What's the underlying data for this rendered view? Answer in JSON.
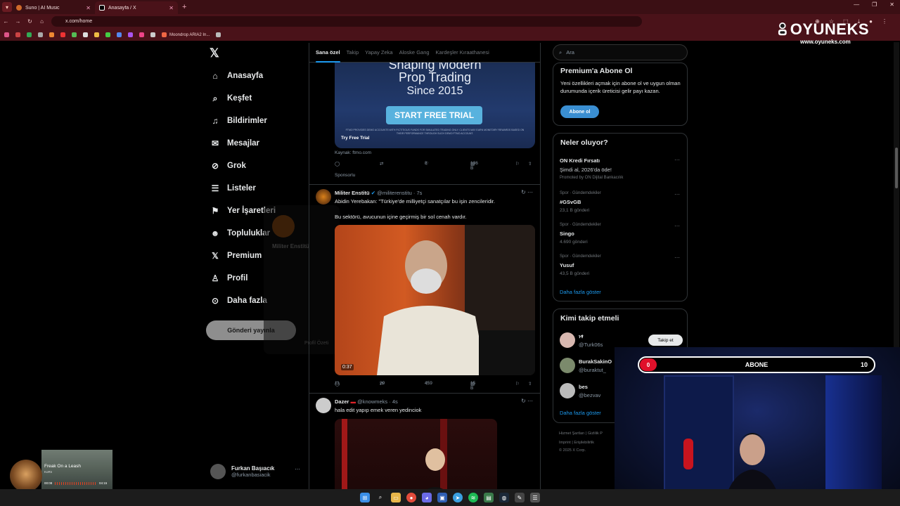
{
  "browser": {
    "tabs": [
      {
        "title": "Suno | AI Music",
        "active": false
      },
      {
        "title": "Anasayfa / X",
        "active": true
      }
    ],
    "url": "x.com/home",
    "bookmark_label": "Moondrop ARIA2 In..."
  },
  "overlay_logo": {
    "brand": "OYUNEKS",
    "site": "www.oyuneks.com"
  },
  "nav": {
    "items": [
      {
        "label": "Anasayfa",
        "icon": "home-icon"
      },
      {
        "label": "Keşfet",
        "icon": "search-icon"
      },
      {
        "label": "Bildirimler",
        "icon": "bell-icon"
      },
      {
        "label": "Mesajlar",
        "icon": "mail-icon"
      },
      {
        "label": "Grok",
        "icon": "grok-icon"
      },
      {
        "label": "Listeler",
        "icon": "list-icon"
      },
      {
        "label": "Yer İşaretleri",
        "icon": "bookmark-icon"
      },
      {
        "label": "Topluluklar",
        "icon": "communities-icon"
      },
      {
        "label": "Premium",
        "icon": "x-logo-icon"
      },
      {
        "label": "Profil",
        "icon": "person-icon"
      },
      {
        "label": "Daha fazla",
        "icon": "more-circle-icon"
      }
    ],
    "post_button": "Gönderi yayınla",
    "user": {
      "name": "Furkan Başıacık",
      "handle": "@furkanbasiacik"
    }
  },
  "feed": {
    "tabs": [
      "Sana özel",
      "Takip",
      "Yapay Zeka",
      "Aloske Gang",
      "Kardeşler Kıraathanesi"
    ],
    "ad": {
      "headline_1": "Shaping Modern",
      "headline_2": "Prop Trading",
      "headline_3": "Since 2015",
      "cta": "START FREE TRIAL",
      "disclaimer": "FTMO PROVIDES DEMO ACCOUNTS WITH FICTITIOUS FUNDS FOR SIMULATED TRADING ONLY. CLIENTS MAY EARN MONETARY REWARDS BASED ON THEIR PERFORMANCE THROUGH SUCH DEMO FTMO ACCOUNT.",
      "try_label": "Try Free Trial",
      "source": "Kaynak: ftmo.com",
      "likes": "8",
      "views": "136 B",
      "sponsored": "Sponsorlu"
    },
    "tweets": [
      {
        "name": "Militer Enstitü",
        "handle": "@militerenstitu",
        "time": "7s",
        "text_1": "Abidin Yerebakan: \"Türkiye'de milliyetçi sanatçılar bu işin zencileridir.",
        "text_2": "Bu sektörü, avucunun içine geçirmiş bir sol cenah vardır.",
        "video_time": "0:37",
        "replies": "11",
        "retweets": "29",
        "likes": "459",
        "views": "15 B"
      },
      {
        "name": "Dazer",
        "handle": "@knowmeks",
        "time": "4s",
        "text_1": "hala edit yapıp emek veren yedinciok"
      }
    ]
  },
  "hover_card": {
    "name": "Militer Enstitü",
    "label": "Profil Özeti"
  },
  "right": {
    "search_placeholder": "Ara",
    "premium": {
      "title": "Premium'a Abone Ol",
      "text": "Yeni özellikleri açmak için abone ol ve uygun olman durumunda içerik üreticisi gelir payı kazan.",
      "button": "Abone ol"
    },
    "trends": {
      "title": "Neler oluyor?",
      "promo_name": "ON Kredi Fırsatı",
      "promo_text": "Şimdi al, 2026'da öde!",
      "promo_by": "Promoted by ON Dijital Bankacılık",
      "items": [
        {
          "meta": "Spor · Gündemdekiler",
          "name": "#GSvGB",
          "count": "23,1 B gönderi"
        },
        {
          "meta": "Spor · Gündemdekiler",
          "name": "Singo",
          "count": "4.690 gönderi"
        },
        {
          "meta": "Spor · Gündemdekiler",
          "name": "Yusuf",
          "count": "43,5 B gönderi"
        }
      ],
      "more": "Daha fazla göster"
    },
    "who_to_follow": {
      "title": "Kimi takip etmeli",
      "users": [
        {
          "name": "ነፃ",
          "handle": "@Turk06s"
        },
        {
          "name": "BurakSakinO",
          "handle": "@buraktut_"
        },
        {
          "name": "bes",
          "handle": "@bezvav"
        }
      ],
      "follow_label": "Takip et",
      "more": "Daha fazla göster"
    },
    "footer": [
      "Hizmet Şartları",
      "Gizlilik P",
      "Imprint",
      "Erişilebilirlik",
      "© 2025 X Corp."
    ]
  },
  "stream_overlay": {
    "goal_label": "ABONE",
    "goal_current": "0",
    "goal_target": "10",
    "music": {
      "title": "Freak On a Leash",
      "artist": "KoRn",
      "elapsed": "00:08",
      "total": "04:15",
      "progress": 0.7
    }
  }
}
